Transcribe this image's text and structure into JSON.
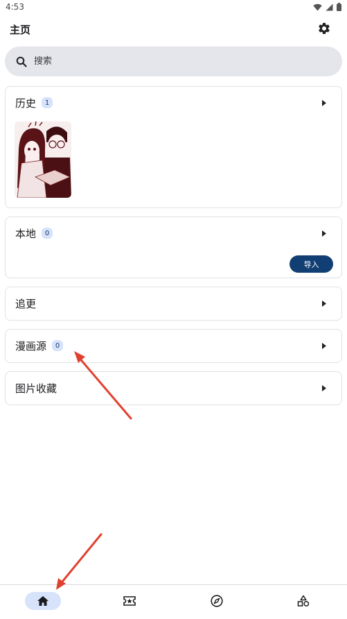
{
  "status_bar": {
    "time": "4:53",
    "icons": [
      "wifi-icon",
      "signal-icon",
      "battery-icon"
    ]
  },
  "header": {
    "title": "主页",
    "settings_icon": "gear-icon"
  },
  "search": {
    "placeholder": "搜索",
    "icon": "search-icon"
  },
  "sections": [
    {
      "id": "history",
      "title": "历史",
      "count": "1"
    },
    {
      "id": "local",
      "title": "本地",
      "count": "0",
      "action_label": "导入"
    },
    {
      "id": "following",
      "title": "追更"
    },
    {
      "id": "sources",
      "title": "漫画源",
      "count": "0"
    },
    {
      "id": "favorites",
      "title": "图片收藏"
    }
  ],
  "bottom_nav": [
    {
      "id": "home",
      "icon": "home-icon",
      "active": true
    },
    {
      "id": "ticket",
      "icon": "ticket-star-icon",
      "active": false
    },
    {
      "id": "explore",
      "icon": "compass-icon",
      "active": false
    },
    {
      "id": "categories",
      "icon": "shapes-icon",
      "active": false
    }
  ],
  "colors": {
    "accent": "#113f74",
    "badge_bg": "#d6e3fb",
    "annotation": "#e0412f"
  }
}
